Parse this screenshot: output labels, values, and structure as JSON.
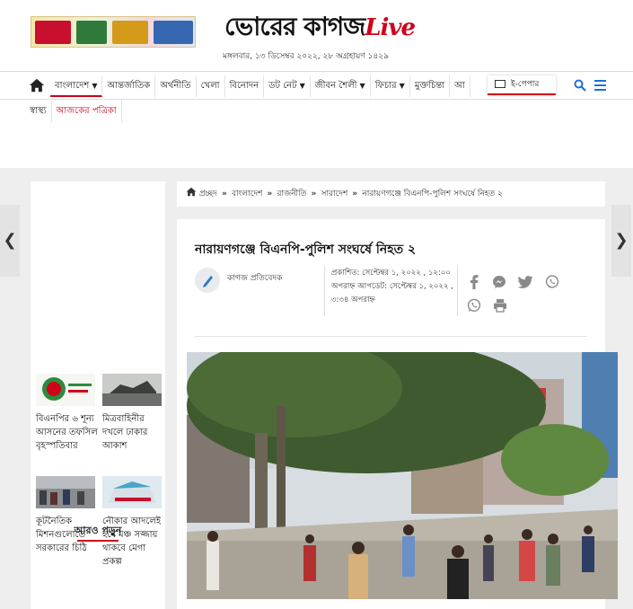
{
  "header": {
    "logo_main": "ভোরের কাগজ",
    "logo_suffix": "Live",
    "date": "মঙ্গলবার, ১৩ ডিসেম্বর ২০২২, ২৮ অগ্রহায়ণ ১৪২৯",
    "ad_icon": "advertisement-banner"
  },
  "nav": {
    "items": [
      {
        "label": "বাংলাদেশ",
        "dropdown": true,
        "active": true
      },
      {
        "label": "আন্তর্জাতিক",
        "dropdown": false
      },
      {
        "label": "অর্থনীতি",
        "dropdown": false
      },
      {
        "label": "খেলা",
        "dropdown": false
      },
      {
        "label": "বিনোদন",
        "dropdown": false
      },
      {
        "label": "ডট নেট",
        "dropdown": true
      },
      {
        "label": "জীবন শৈলী",
        "dropdown": true
      },
      {
        "label": "ফিচার",
        "dropdown": true
      },
      {
        "label": "মুক্তচিন্তা",
        "dropdown": false
      },
      {
        "label": "আ",
        "dropdown": false
      }
    ],
    "epaper": "ই-পেপার",
    "sub_items": [
      {
        "label": "স্বাস্থ্য",
        "red": false
      },
      {
        "label": "আজকের পত্রিকা",
        "red": true
      }
    ],
    "accent_color": "#d0021b",
    "search_color": "#1e6fd9"
  },
  "sidebar": {
    "heading": "আরও পড়ুন",
    "cards": [
      {
        "title": "বিএনপির ৬ শূন্য আসনের তফসিল বৃহস্পতিবার"
      },
      {
        "title": "মিত্রবাহিনীর দখলে ঢাকার আকাশ"
      },
      {
        "title": "কূটনৈতিক মিশনগুলোতে সরকারের চিঠি"
      },
      {
        "title": "নৌকার আদলেই হবে মঞ্চ সজ্জায় থাকবে মেগা প্রকল্প"
      }
    ]
  },
  "breadcrumb": [
    "প্রচ্ছদ",
    "বাংলাদেশ",
    "রাজনীতি",
    "সারাদেশ",
    "নারায়ণগঞ্জে বিএনপি-পুলিশ সংঘর্ষে নিহত ২"
  ],
  "article": {
    "headline": "নারায়ণগঞ্জে বিএনপি-পুলিশ সংঘর্ষে নিহত ২",
    "author": "কাগজ প্রতিবেদক",
    "published": "প্রকাশিত: সেপ্টেম্বর ১, ২০২২ , ১২:০০",
    "updated": "অপরাহ্ন আপডেট: সেপ্টেম্বর ১, ২০২২ , ৩:৩৪ অপরাহ্ন"
  }
}
